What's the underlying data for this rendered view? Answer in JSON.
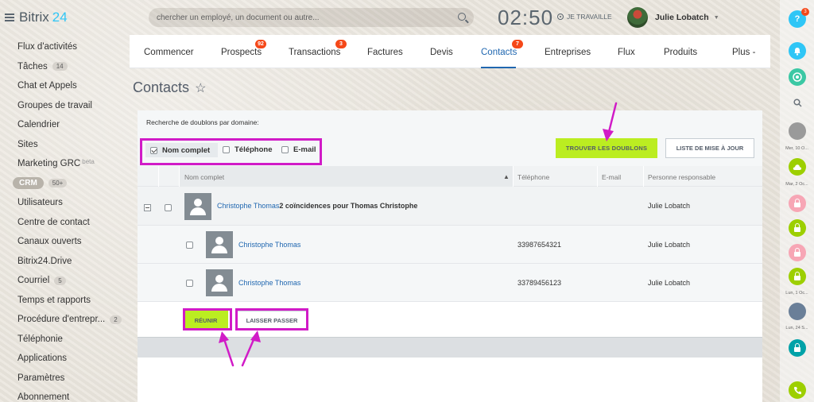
{
  "app": {
    "logo_name": "Bitrix",
    "logo_number": "24"
  },
  "sidebar": {
    "items": [
      {
        "label": "Flux d'activités"
      },
      {
        "label": "Tâches",
        "badge": "14"
      },
      {
        "label": "Chat et Appels"
      },
      {
        "label": "Groupes de travail"
      },
      {
        "label": "Calendrier"
      },
      {
        "label": "Sites"
      },
      {
        "label": "Marketing GRC",
        "tag": "beta"
      },
      {
        "label": "CRM",
        "badge": "50+"
      },
      {
        "label": "Utilisateurs"
      },
      {
        "label": "Centre de contact"
      },
      {
        "label": "Canaux ouverts"
      },
      {
        "label": "Bitrix24.Drive"
      },
      {
        "label": "Courriel",
        "badge": "5"
      },
      {
        "label": "Temps et rapports"
      },
      {
        "label": "Procédure d'entrepr...",
        "badge": "2"
      },
      {
        "label": "Téléphonie"
      },
      {
        "label": "Applications"
      },
      {
        "label": "Paramètres"
      },
      {
        "label": "Abonnement"
      }
    ]
  },
  "header": {
    "search_placeholder": "chercher un employé, un document ou autre...",
    "clock": "02:50",
    "work_status": "JE TRAVAILLE",
    "user_name": "Julie Lobatch"
  },
  "rightbar": {
    "help_badge": "3",
    "labels": [
      "Mer, 10 O...",
      "Mar, 2 Oc...",
      "Lun, 1 Oc...",
      "Lun, 24 S..."
    ],
    "colors": {
      "help": "#2fc6f6",
      "bell": "#2fc6f6",
      "green": "#3bc8a4",
      "lime": "#9dcf00",
      "pink": "#f7a6b5",
      "teal": "#00a2a8"
    }
  },
  "tabs": [
    {
      "label": "Commencer"
    },
    {
      "label": "Prospects",
      "badge": "92"
    },
    {
      "label": "Transactions",
      "badge": "3"
    },
    {
      "label": "Factures"
    },
    {
      "label": "Devis"
    },
    {
      "label": "Contacts",
      "badge": "7",
      "active": true
    },
    {
      "label": "Entreprises"
    },
    {
      "label": "Flux"
    },
    {
      "label": "Produits"
    },
    {
      "label": "Plus -"
    }
  ],
  "page": {
    "title": "Contacts",
    "star_icon": "☆"
  },
  "filter": {
    "caption": "Recherche de doublons par domaine:",
    "options": [
      {
        "label": "Nom complet",
        "checked": true
      },
      {
        "label": "Téléphone",
        "checked": false
      },
      {
        "label": "E-mail",
        "checked": false
      }
    ],
    "find_button": "TROUVER LES DOUBLONS",
    "list_button": "LISTE DE MISE À JOUR"
  },
  "grid": {
    "columns": [
      "Nom complet",
      "Téléphone",
      "E-mail",
      "Personne responsable"
    ],
    "sort_indicator": "▲",
    "group": {
      "name": "Christophe Thomas",
      "matches_text": "2 coïncidences pour Thomas Christophe",
      "responsible": "Julie Lobatch"
    },
    "rows": [
      {
        "name": "Christophe Thomas",
        "phone": "33987654321",
        "responsible": "Julie Lobatch"
      },
      {
        "name": "Christophe Thomas",
        "phone": "33789456123",
        "responsible": "Julie Lobatch"
      }
    ],
    "merge_button": "RÉUNIR",
    "skip_button": "LAISSER PASSER"
  },
  "annotation_color": "#d11bc7"
}
